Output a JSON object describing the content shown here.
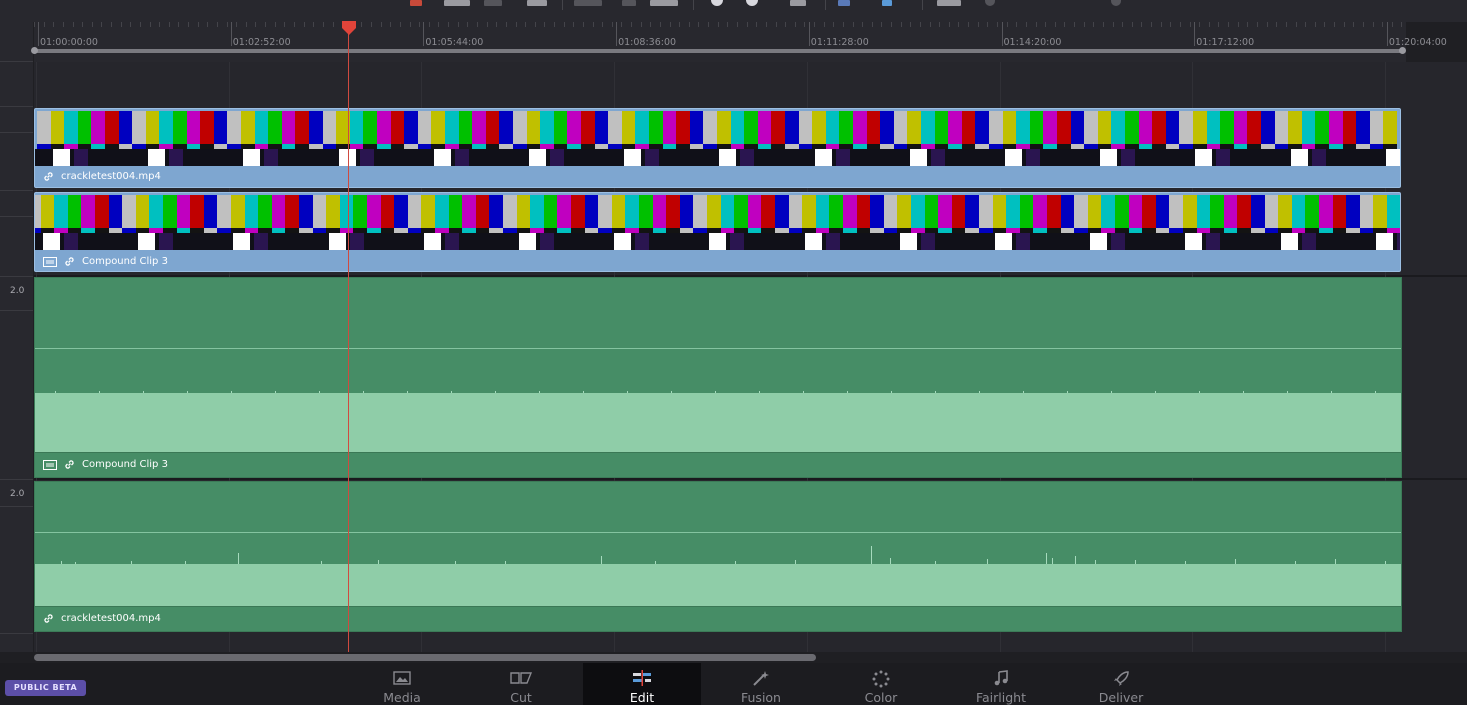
{
  "ruler": {
    "timecodes": [
      "01:00:00:00",
      "01:02:52:00",
      "01:05:44:00",
      "01:08:36:00",
      "01:11:28:00",
      "01:14:20:00",
      "01:17:12:00",
      "01:20:04:00"
    ]
  },
  "track_headers": {
    "audio1_level": "2.0",
    "audio2_level": "2.0"
  },
  "clips": {
    "video2": {
      "name": "crackletest004.mp4"
    },
    "video1": {
      "name": "Compound Clip 3"
    },
    "audio1": {
      "name": "Compound Clip 3"
    },
    "audio2": {
      "name": "crackletest004.mp4"
    }
  },
  "badge": {
    "label": "PUBLIC BETA"
  },
  "pages": [
    {
      "label": "Media",
      "icon": "media-icon"
    },
    {
      "label": "Cut",
      "icon": "cut-icon"
    },
    {
      "label": "Edit",
      "icon": "edit-icon",
      "active": true
    },
    {
      "label": "Fusion",
      "icon": "fusion-icon"
    },
    {
      "label": "Color",
      "icon": "color-icon"
    },
    {
      "label": "Fairlight",
      "icon": "fairlight-icon"
    },
    {
      "label": "Deliver",
      "icon": "deliver-icon"
    }
  ],
  "colors": {
    "video_clip": "#7ea6d0",
    "audio_clip": "#468d66",
    "audio_wave": "#8fcda8",
    "playhead": "#d04a40",
    "beta_badge": "#5c4fa8"
  }
}
